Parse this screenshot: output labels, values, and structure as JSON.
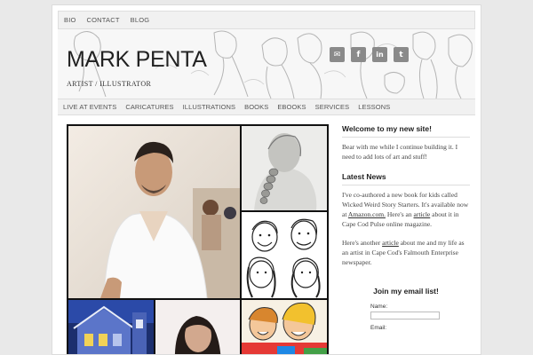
{
  "top_nav": [
    "BIO",
    "CONTACT",
    "BLOG"
  ],
  "header": {
    "site_title": "MARK PENTA",
    "tagline": "ARTIST / ILLUSTRATOR"
  },
  "social": [
    {
      "name": "email",
      "glyph": "✉"
    },
    {
      "name": "facebook",
      "glyph": "f"
    },
    {
      "name": "linkedin",
      "glyph": "in"
    },
    {
      "name": "twitter",
      "glyph": "t"
    }
  ],
  "main_nav": [
    "LIVE AT EVENTS",
    "CARICATURES",
    "ILLUSTRATIONS",
    "BOOKS",
    "EBOOKS",
    "SERVICES",
    "LESSONS"
  ],
  "sidebar": {
    "welcome_title": "Welcome to my new site!",
    "welcome_text": "Bear with me while I continue building it. I need to add lots of art and stuff!",
    "news_title": "Latest News",
    "news_p1_a": "I've co-authored a new book for kids called Wicked Weird Story Starters. It's available now at ",
    "news_p1_link1": "Amazon.com.",
    "news_p1_b": " Here's an ",
    "news_p1_link2": "article",
    "news_p1_c": " about it in Cape Cod Pulse online magazine.",
    "news_p2_a": "Here's another ",
    "news_p2_link": "article",
    "news_p2_b": " about me and my life as an artist in Cape Cod's Falmouth Enterprise newspaper.",
    "email_title": "Join my email list!",
    "name_label": "Name:",
    "email_label": "Email:"
  },
  "colors": {
    "page_bg": "#e9e9e9",
    "nav_bg": "#f1f1f1",
    "text": "#222222",
    "icon_bg": "#8a8a8a"
  }
}
